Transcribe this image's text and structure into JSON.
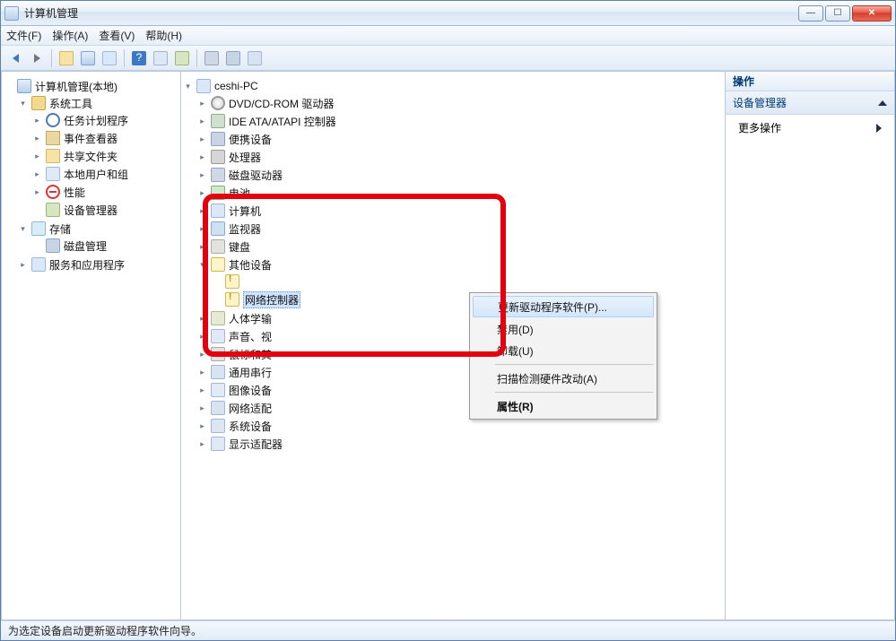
{
  "window": {
    "title": "计算机管理"
  },
  "menu": {
    "file": "文件(F)",
    "action": "操作(A)",
    "view": "查看(V)",
    "help": "帮助(H)"
  },
  "left_tree": {
    "root": "计算机管理(本地)",
    "system_tools": "系统工具",
    "task_scheduler": "任务计划程序",
    "event_viewer": "事件查看器",
    "shared_folders": "共享文件夹",
    "local_users": "本地用户和组",
    "performance": "性能",
    "device_manager": "设备管理器",
    "storage": "存储",
    "disk_mgmt": "磁盘管理",
    "services_apps": "服务和应用程序"
  },
  "center_tree": {
    "root": "ceshi-PC",
    "dvd": "DVD/CD-ROM 驱动器",
    "ide": "IDE ATA/ATAPI 控制器",
    "portable": "便携设备",
    "cpu": "处理器",
    "disk_drives": "磁盘驱动器",
    "battery": "电池",
    "computer": "计算机",
    "monitor": "监视器",
    "keyboard": "键盘",
    "other": "其他设备",
    "other_unknown": "",
    "network_controller": "网络控制器",
    "hid": "人体学输",
    "sound": "声音、视",
    "mouse": "鼠标和其",
    "usb": "通用串行",
    "imaging": "图像设备",
    "netadapter": "网络适配",
    "system": "系统设备",
    "display": "显示适配器"
  },
  "context_menu": {
    "update": "更新驱动程序软件(P)...",
    "disable": "禁用(D)",
    "uninstall": "卸载(U)",
    "scan": "扫描检测硬件改动(A)",
    "properties": "属性(R)"
  },
  "right": {
    "header": "操作",
    "section": "设备管理器",
    "more": "更多操作"
  },
  "status": "为选定设备启动更新驱动程序软件向导。"
}
